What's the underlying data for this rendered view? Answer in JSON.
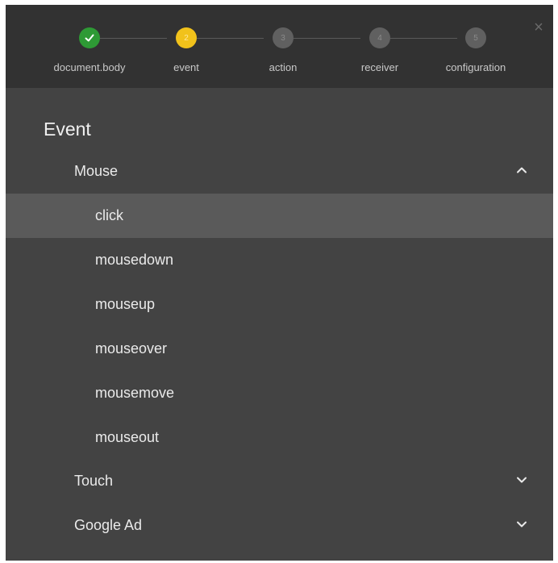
{
  "close": {
    "symbol": "×"
  },
  "steps": [
    {
      "number": "",
      "label": "document.body",
      "state": "done"
    },
    {
      "number": "2",
      "label": "event",
      "state": "active"
    },
    {
      "number": "3",
      "label": "action",
      "state": "pending"
    },
    {
      "number": "4",
      "label": "receiver",
      "state": "pending"
    },
    {
      "number": "5",
      "label": "configuration",
      "state": "pending"
    }
  ],
  "section": {
    "title": "Event"
  },
  "groups": [
    {
      "label": "Mouse",
      "expanded": true,
      "items": [
        {
          "label": "click",
          "selected": true
        },
        {
          "label": "mousedown",
          "selected": false
        },
        {
          "label": "mouseup",
          "selected": false
        },
        {
          "label": "mouseover",
          "selected": false
        },
        {
          "label": "mousemove",
          "selected": false
        },
        {
          "label": "mouseout",
          "selected": false
        }
      ]
    },
    {
      "label": "Touch",
      "expanded": false,
      "items": []
    },
    {
      "label": "Google Ad",
      "expanded": false,
      "items": []
    }
  ],
  "colors": {
    "done": "#2e9a35",
    "active": "#f1c21b",
    "pending": "#606060",
    "panel": "#434343",
    "header": "#323232",
    "selected": "#5a5a5a"
  }
}
